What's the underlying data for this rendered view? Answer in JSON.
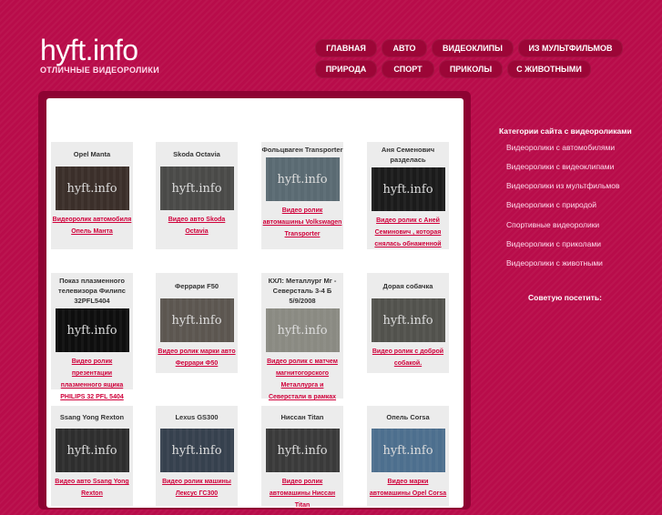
{
  "site": {
    "title": "hyft.info",
    "subtitle": "ОТЛИЧНЫЕ ВИДЕОРОЛИКИ"
  },
  "nav": [
    {
      "label": "ГЛАВНАЯ"
    },
    {
      "label": "АВТО"
    },
    {
      "label": "ВИДЕОКЛИПЫ"
    },
    {
      "label": "ИЗ МУЛЬТФИЛЬМОВ"
    },
    {
      "label": "ПРИРОДА"
    },
    {
      "label": "СПОРТ"
    },
    {
      "label": "ПРИКОЛЫ"
    },
    {
      "label": "С ЖИВОТНЫМИ"
    }
  ],
  "watermark": "hyft.info",
  "videos": [
    {
      "title": "Opel Manta",
      "link": "Видеоролик автомобиля Опель Манта"
    },
    {
      "title": "Skoda Octavia",
      "link": "Видео авто Skoda Octavia"
    },
    {
      "title": "Фольцваген Transporter",
      "link": "Видео ролик автомашины Volkswagen Transporter"
    },
    {
      "title": "Аня Семенович разделась",
      "link": "Видео ролик с Аней Семинович , которая снялась обнаженной"
    },
    {
      "title": "Показ плазменного телевизора Филипс 32PFL5404",
      "link": "Видео ролик презентации плазменного ящика PHILIPS 32 PFL 5404"
    },
    {
      "title": "Феррари F50",
      "link": "Видео ролик марки авто Феррари Ф50"
    },
    {
      "title": "КХЛ: Металлург Мг - Северсталь 3-4 Б 5/9/2008",
      "link": "Видео ролик с матчем магнитогорского Металлурга и Северстали в рамках КХЛ"
    },
    {
      "title": "Дорая собачка",
      "link": "Видео ролик с доброй собакой."
    },
    {
      "title": "Ssang Yong Rexton",
      "link": "Видео авто Ssang Yong Rexton"
    },
    {
      "title": "Lexus GS300",
      "link": "Видео ролик машины Лексус ГС300"
    },
    {
      "title": "Ниссан Titan",
      "link": "Видео ролик автомашины Ниссан Titan"
    },
    {
      "title": "Опель Corsa",
      "link": "Видео марки автомашины Opel Corsa"
    }
  ],
  "sidebar": {
    "heading": "Категории сайта с видеороликами",
    "links": [
      "Видеоролики с автомобилями",
      "Видеоролики с видеоклипами",
      "Видеоролики из мультфильмов",
      "Видеоролики с природой",
      "Спортивные видеоролики",
      "Видеоролики с приколами",
      "Видеоролики с животными"
    ],
    "recommend": "Советую посетить:"
  }
}
